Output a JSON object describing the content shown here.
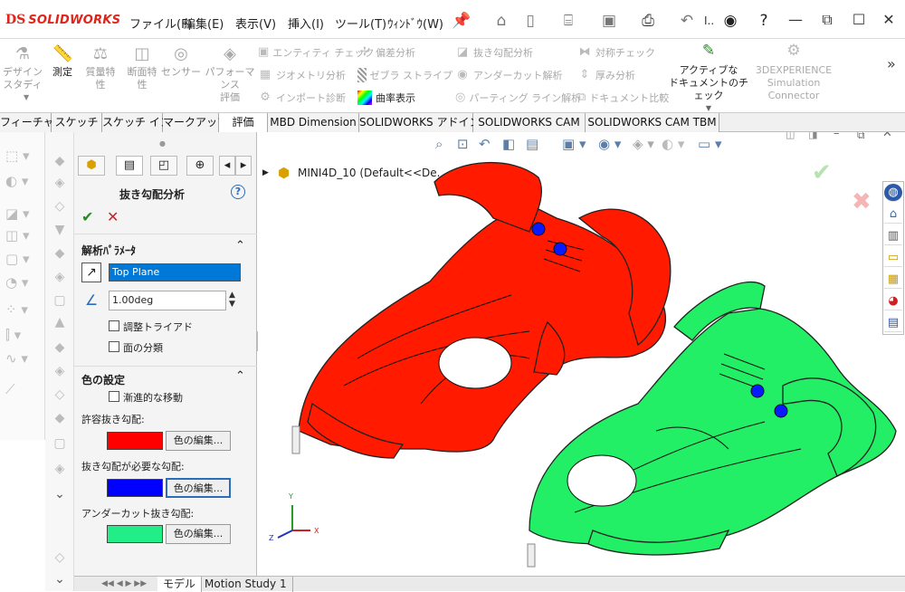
{
  "app": {
    "brand_prefix": "DS",
    "brand": "SOLIDWORKS"
  },
  "menu": [
    "ファイル(F)",
    "編集(E)",
    "表示(V)",
    "挿入(I)",
    "ツール(T)",
    "ｳｨﾝﾄﾞｳ(W)"
  ],
  "quick_access": {
    "search_placeholder": "I.."
  },
  "ribbon": {
    "big": [
      {
        "label": "デザイン\nスタディ",
        "enabled": false,
        "icon": "design-study-icon"
      },
      {
        "label": "測定",
        "enabled": true,
        "icon": "measure-icon"
      },
      {
        "label": "質量特\n性",
        "enabled": false,
        "icon": "mass-properties-icon"
      },
      {
        "label": "断面特\n性",
        "enabled": false,
        "icon": "section-properties-icon"
      },
      {
        "label": "センサー",
        "enabled": false,
        "icon": "sensor-icon"
      },
      {
        "label": "パフォーマンス\n評価",
        "enabled": false,
        "icon": "performance-icon"
      }
    ],
    "col1": [
      {
        "label": "エンティティ チェック",
        "enabled": false
      },
      {
        "label": "ジオメトリ分析",
        "enabled": false
      },
      {
        "label": "インポート診断",
        "enabled": false
      }
    ],
    "col2": [
      {
        "label": "偏差分析",
        "enabled": false
      },
      {
        "label": "ゼブラ ストライプ",
        "enabled": false
      },
      {
        "label": "曲率表示",
        "enabled": true
      }
    ],
    "col3": [
      {
        "label": "抜き勾配分析",
        "enabled": false
      },
      {
        "label": "アンダーカット解析",
        "enabled": false
      },
      {
        "label": "パーティング ライン解析",
        "enabled": false
      }
    ],
    "col4": [
      {
        "label": "対称チェック",
        "enabled": false
      },
      {
        "label": "厚み分析",
        "enabled": false
      },
      {
        "label": "ドキュメント比較",
        "enabled": false
      }
    ],
    "active_doc_check": "アクティブな\nドキュメントのチェック",
    "connector": "3DEXPERIENCE\nSimulation\nConnector",
    "more": "»"
  },
  "tabs": [
    {
      "label": "フィーチャー",
      "active": false
    },
    {
      "label": "スケッチ",
      "active": false
    },
    {
      "label": "スケッチ インク",
      "active": false
    },
    {
      "label": "マークアップ",
      "active": false
    },
    {
      "label": "評価",
      "active": true
    },
    {
      "label": "MBD Dimension",
      "active": false
    },
    {
      "label": "SOLIDWORKS アドイン",
      "active": false
    },
    {
      "label": "SOLIDWORKS CAM",
      "active": false
    },
    {
      "label": "SOLIDWORKS CAM TBM",
      "active": false
    }
  ],
  "pm": {
    "title": "抜き勾配分析",
    "help": "?",
    "ok": "✔",
    "cancel": "✕",
    "params": {
      "heading": "解析ﾊﾟﾗﾒｰﾀ",
      "direction": "Top Plane",
      "angle": "1.00deg",
      "adjust_triad": "調整トライアド",
      "face_classification": "面の分類"
    },
    "colors": {
      "heading": "色の設定",
      "gradual": "漸進的な移動",
      "positive_label": "許容抜き勾配:",
      "positive_color": "#ff0000",
      "required_label": "抜き勾配が必要な勾配:",
      "required_color": "#0000ff",
      "undercut_label": "アンダーカット抜き勾配:",
      "undercut_color": "#22ee88",
      "edit_label": "色の編集..."
    }
  },
  "viewport": {
    "tree_label": "MINI4D_10  (Default<<De...",
    "model_red": "#ff1a00",
    "model_green": "#22ee66",
    "model_blue": "#0a1aff",
    "triad": {
      "x": "X",
      "y": "Y",
      "z": "Z"
    }
  },
  "bottom": {
    "tabs": [
      "モデル",
      "Motion Study 1"
    ]
  }
}
